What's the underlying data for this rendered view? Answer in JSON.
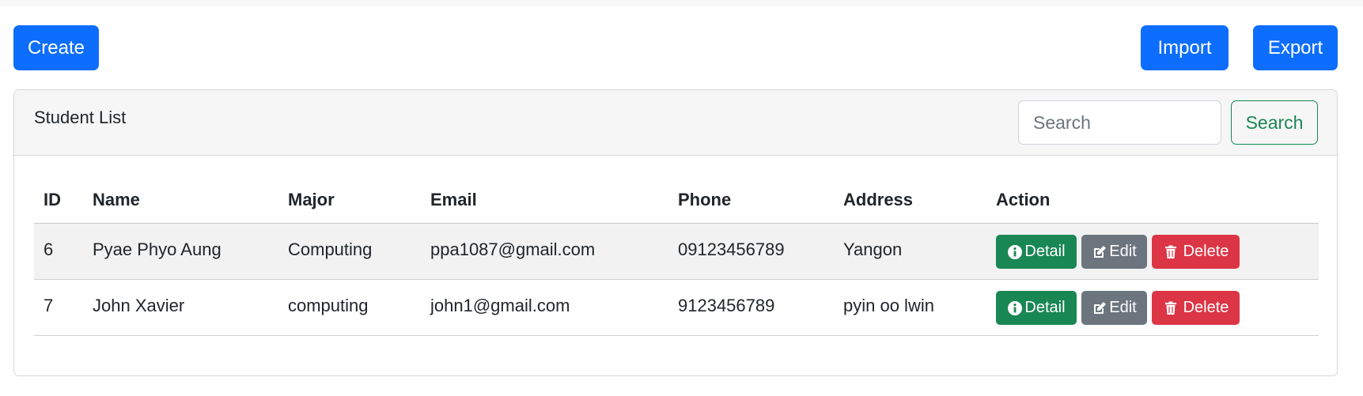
{
  "toolbar": {
    "create_label": "Create",
    "import_label": "Import",
    "export_label": "Export"
  },
  "card": {
    "title": "Student List",
    "search_placeholder": "Search",
    "search_value": "",
    "search_button": "Search"
  },
  "table": {
    "headers": [
      "ID",
      "Name",
      "Major",
      "Email",
      "Phone",
      "Address",
      "Action"
    ],
    "rows": [
      {
        "id": "6",
        "name": "Pyae Phyo Aung",
        "major": "Computing",
        "email": "ppa1087@gmail.com",
        "phone": "09123456789",
        "address": "Yangon"
      },
      {
        "id": "7",
        "name": "John Xavier",
        "major": "computing",
        "email": "john1@gmail.com",
        "phone": "9123456789",
        "address": "pyin oo lwin"
      }
    ],
    "actions": {
      "detail": "Detail",
      "edit": "Edit",
      "delete": "Delete",
      "detail_icon": "info-circle-icon",
      "edit_icon": "pencil-square-icon",
      "delete_icon": "trash-icon"
    }
  },
  "colors": {
    "primary": "#0d6efd",
    "success": "#198754",
    "secondary": "#6c757d",
    "danger": "#dc3545"
  }
}
